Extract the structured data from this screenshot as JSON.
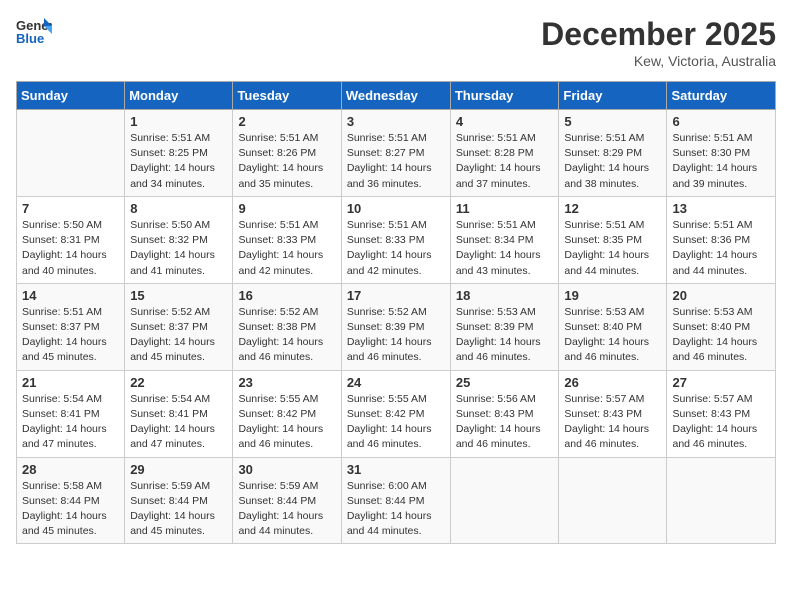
{
  "header": {
    "logo_general": "General",
    "logo_blue": "Blue",
    "title": "December 2025",
    "subtitle": "Kew, Victoria, Australia"
  },
  "days_of_week": [
    "Sunday",
    "Monday",
    "Tuesday",
    "Wednesday",
    "Thursday",
    "Friday",
    "Saturday"
  ],
  "weeks": [
    [
      {
        "day": "",
        "info": ""
      },
      {
        "day": "1",
        "info": "Sunrise: 5:51 AM\nSunset: 8:25 PM\nDaylight: 14 hours\nand 34 minutes."
      },
      {
        "day": "2",
        "info": "Sunrise: 5:51 AM\nSunset: 8:26 PM\nDaylight: 14 hours\nand 35 minutes."
      },
      {
        "day": "3",
        "info": "Sunrise: 5:51 AM\nSunset: 8:27 PM\nDaylight: 14 hours\nand 36 minutes."
      },
      {
        "day": "4",
        "info": "Sunrise: 5:51 AM\nSunset: 8:28 PM\nDaylight: 14 hours\nand 37 minutes."
      },
      {
        "day": "5",
        "info": "Sunrise: 5:51 AM\nSunset: 8:29 PM\nDaylight: 14 hours\nand 38 minutes."
      },
      {
        "day": "6",
        "info": "Sunrise: 5:51 AM\nSunset: 8:30 PM\nDaylight: 14 hours\nand 39 minutes."
      }
    ],
    [
      {
        "day": "7",
        "info": "Sunrise: 5:50 AM\nSunset: 8:31 PM\nDaylight: 14 hours\nand 40 minutes."
      },
      {
        "day": "8",
        "info": "Sunrise: 5:50 AM\nSunset: 8:32 PM\nDaylight: 14 hours\nand 41 minutes."
      },
      {
        "day": "9",
        "info": "Sunrise: 5:51 AM\nSunset: 8:33 PM\nDaylight: 14 hours\nand 42 minutes."
      },
      {
        "day": "10",
        "info": "Sunrise: 5:51 AM\nSunset: 8:33 PM\nDaylight: 14 hours\nand 42 minutes."
      },
      {
        "day": "11",
        "info": "Sunrise: 5:51 AM\nSunset: 8:34 PM\nDaylight: 14 hours\nand 43 minutes."
      },
      {
        "day": "12",
        "info": "Sunrise: 5:51 AM\nSunset: 8:35 PM\nDaylight: 14 hours\nand 44 minutes."
      },
      {
        "day": "13",
        "info": "Sunrise: 5:51 AM\nSunset: 8:36 PM\nDaylight: 14 hours\nand 44 minutes."
      }
    ],
    [
      {
        "day": "14",
        "info": "Sunrise: 5:51 AM\nSunset: 8:37 PM\nDaylight: 14 hours\nand 45 minutes."
      },
      {
        "day": "15",
        "info": "Sunrise: 5:52 AM\nSunset: 8:37 PM\nDaylight: 14 hours\nand 45 minutes."
      },
      {
        "day": "16",
        "info": "Sunrise: 5:52 AM\nSunset: 8:38 PM\nDaylight: 14 hours\nand 46 minutes."
      },
      {
        "day": "17",
        "info": "Sunrise: 5:52 AM\nSunset: 8:39 PM\nDaylight: 14 hours\nand 46 minutes."
      },
      {
        "day": "18",
        "info": "Sunrise: 5:53 AM\nSunset: 8:39 PM\nDaylight: 14 hours\nand 46 minutes."
      },
      {
        "day": "19",
        "info": "Sunrise: 5:53 AM\nSunset: 8:40 PM\nDaylight: 14 hours\nand 46 minutes."
      },
      {
        "day": "20",
        "info": "Sunrise: 5:53 AM\nSunset: 8:40 PM\nDaylight: 14 hours\nand 46 minutes."
      }
    ],
    [
      {
        "day": "21",
        "info": "Sunrise: 5:54 AM\nSunset: 8:41 PM\nDaylight: 14 hours\nand 47 minutes."
      },
      {
        "day": "22",
        "info": "Sunrise: 5:54 AM\nSunset: 8:41 PM\nDaylight: 14 hours\nand 47 minutes."
      },
      {
        "day": "23",
        "info": "Sunrise: 5:55 AM\nSunset: 8:42 PM\nDaylight: 14 hours\nand 46 minutes."
      },
      {
        "day": "24",
        "info": "Sunrise: 5:55 AM\nSunset: 8:42 PM\nDaylight: 14 hours\nand 46 minutes."
      },
      {
        "day": "25",
        "info": "Sunrise: 5:56 AM\nSunset: 8:43 PM\nDaylight: 14 hours\nand 46 minutes."
      },
      {
        "day": "26",
        "info": "Sunrise: 5:57 AM\nSunset: 8:43 PM\nDaylight: 14 hours\nand 46 minutes."
      },
      {
        "day": "27",
        "info": "Sunrise: 5:57 AM\nSunset: 8:43 PM\nDaylight: 14 hours\nand 46 minutes."
      }
    ],
    [
      {
        "day": "28",
        "info": "Sunrise: 5:58 AM\nSunset: 8:44 PM\nDaylight: 14 hours\nand 45 minutes."
      },
      {
        "day": "29",
        "info": "Sunrise: 5:59 AM\nSunset: 8:44 PM\nDaylight: 14 hours\nand 45 minutes."
      },
      {
        "day": "30",
        "info": "Sunrise: 5:59 AM\nSunset: 8:44 PM\nDaylight: 14 hours\nand 44 minutes."
      },
      {
        "day": "31",
        "info": "Sunrise: 6:00 AM\nSunset: 8:44 PM\nDaylight: 14 hours\nand 44 minutes."
      },
      {
        "day": "",
        "info": ""
      },
      {
        "day": "",
        "info": ""
      },
      {
        "day": "",
        "info": ""
      }
    ]
  ]
}
